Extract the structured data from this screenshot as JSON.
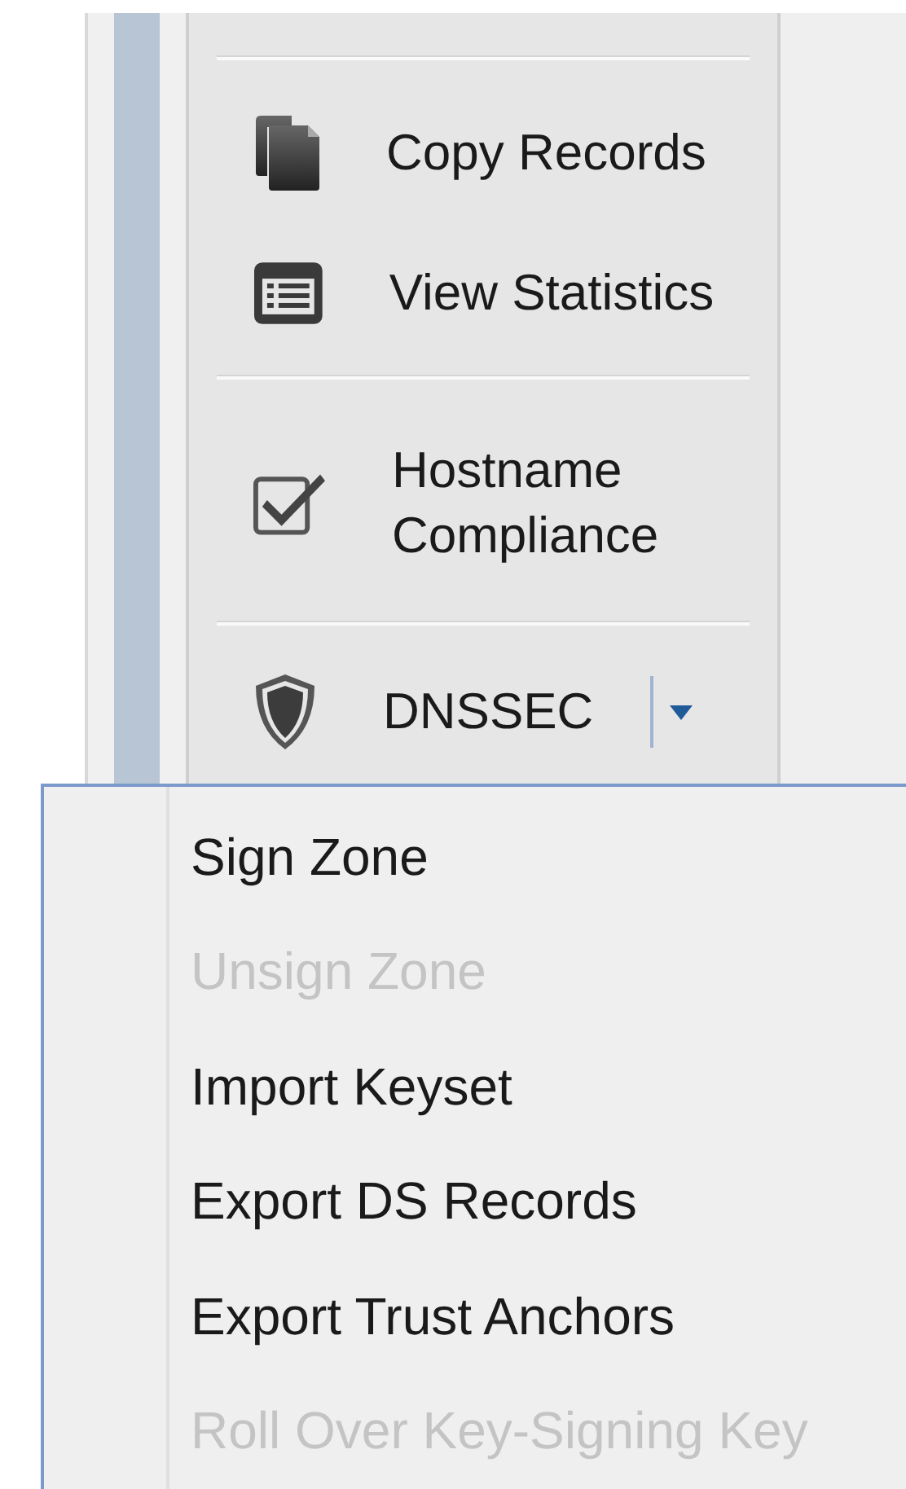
{
  "ribbon_panel": {
    "groups": [
      {
        "items": [
          {
            "label": "Copy Records",
            "kind": "button"
          },
          {
            "label": "View Statistics",
            "kind": "button"
          }
        ]
      },
      {
        "items": [
          {
            "label": "Hostname Compliance",
            "kind": "button"
          }
        ]
      },
      {
        "items": [
          {
            "label": "DNSSEC",
            "kind": "split",
            "expanded": true
          }
        ]
      }
    ]
  },
  "dropdown_menu": {
    "items": [
      {
        "label": "Sign Zone",
        "disabled": false
      },
      {
        "label": "Unsign Zone",
        "disabled": true
      },
      {
        "label": "Import Keyset",
        "disabled": false
      },
      {
        "label": "Export DS Records",
        "disabled": false
      },
      {
        "label": "Export Trust Anchors",
        "disabled": false
      },
      {
        "label": "Roll Over Key-Signing Key",
        "disabled": true
      }
    ]
  }
}
